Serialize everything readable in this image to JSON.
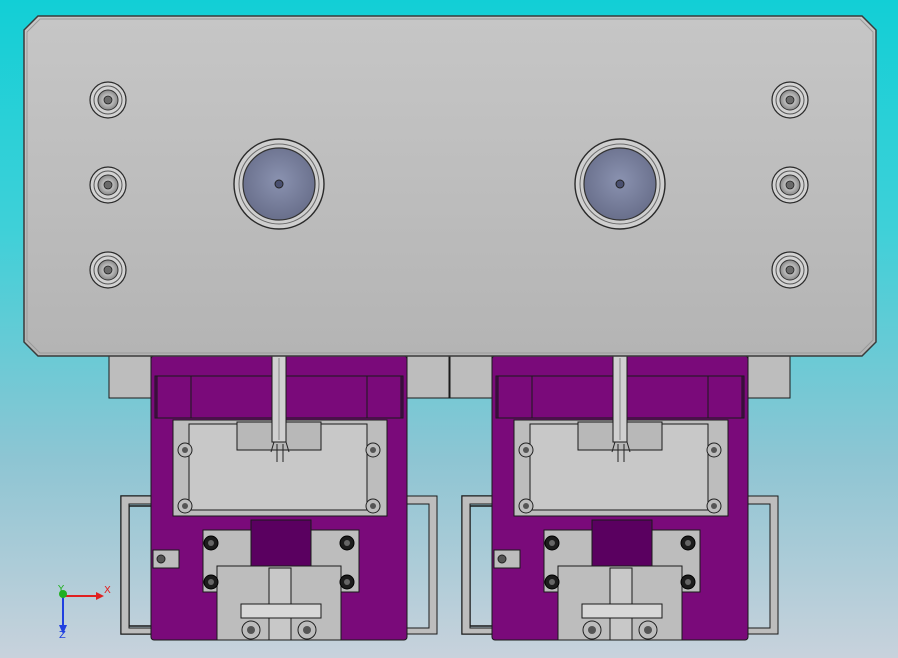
{
  "viewport": {
    "background_top": "#12cfd6",
    "background_bottom": "#c8d2dc",
    "model": {
      "plate_color": "#c0c0c0",
      "plate_edge": "#3a3a3a",
      "bore_face_color": "#7a82a0",
      "fixture_color": "#7a0a7a",
      "fixture_dark": "#5a0060",
      "steel_color": "#bdbdbd",
      "modules": [
        "left-module",
        "right-module"
      ]
    },
    "triad": {
      "x_label": "X",
      "y_label": "Y",
      "z_label": "Z",
      "x_color": "#e02020",
      "y_color": "#20b020",
      "z_color": "#2040e0"
    }
  }
}
